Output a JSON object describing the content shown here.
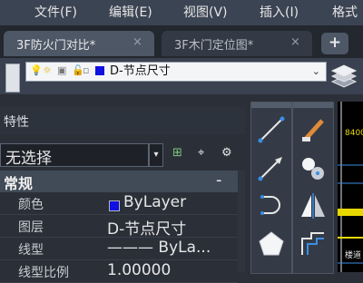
{
  "menubar": {
    "items": [
      "文件(F)",
      "编辑(E)",
      "视图(V)",
      "插入(I)",
      "格式"
    ]
  },
  "tabs": [
    {
      "label": "3F防火门对比*",
      "close": "×",
      "active": true
    },
    {
      "label": "3F木门定位图*",
      "close": "×",
      "active": false
    }
  ],
  "tab_add": "+",
  "layer_toolbar": {
    "current_layer": "D-节点尺寸",
    "layer_color": "#1010e0",
    "dropdown_chevron": "⌄"
  },
  "properties": {
    "title": "特性",
    "selection": "无选择",
    "section": "常规",
    "collapse": "-",
    "rows": [
      {
        "key": "颜色",
        "value": "ByLayer"
      },
      {
        "key": "图层",
        "value": "D-节点尺寸"
      },
      {
        "key": "线型",
        "value": "——— ByLa..."
      },
      {
        "key": "线型比例",
        "value": "1.00000"
      }
    ]
  },
  "drawing_area": {
    "dimension_text": "8400",
    "label": "楼道"
  },
  "colors": {
    "menubar": "#3b4453",
    "panel": "#2b2f38",
    "layer_blue": "#1010e0"
  }
}
